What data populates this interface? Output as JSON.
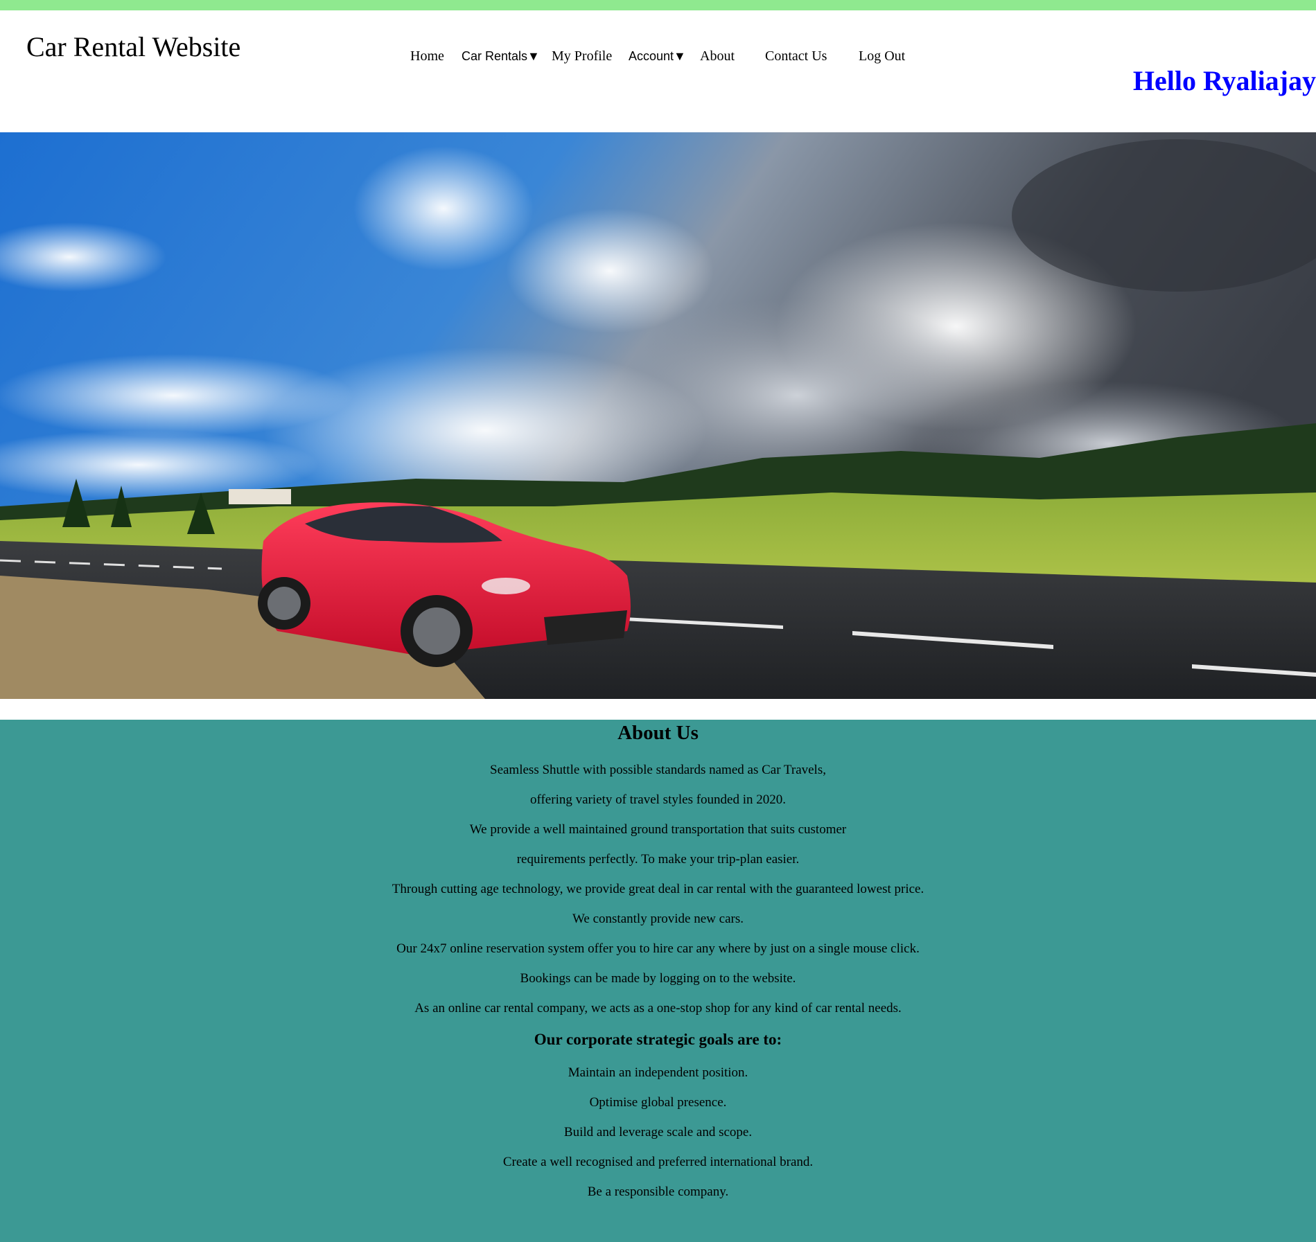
{
  "header": {
    "site_title": "Car Rental Website",
    "greeting": "Hello Ryaliajay",
    "nav": {
      "home": "Home",
      "car_rentals": "Car Rentals▼",
      "my_profile": "My Profile",
      "account": "Account▼",
      "about": "About",
      "contact": "Contact Us",
      "logout": "Log Out"
    }
  },
  "colors": {
    "top_strip": "#8fe98f",
    "about_bg": "#3c9994",
    "greeting": "#0000ff",
    "car": "#e8183a"
  },
  "about": {
    "heading": "About Us",
    "paragraphs": [
      "Seamless Shuttle with possible standards named as Car Travels,",
      "offering variety of travel styles founded in 2020.",
      "We provide a well maintained ground transportation that suits customer",
      "requirements perfectly. To make your trip-plan easier.",
      "Through cutting age technology, we provide great deal in car rental with the guaranteed lowest price.",
      "We constantly provide new cars.",
      "Our 24x7 online reservation system offer you to hire car any where by just on a single mouse click.",
      "Bookings can be made by logging on to the website.",
      "As an online car rental company, we acts as a one-stop shop for any kind of car rental needs."
    ],
    "goals_heading": "Our corporate strategic goals are to:",
    "goals": [
      "Maintain an independent position.",
      "Optimise global presence.",
      "Build and leverage scale and scope.",
      "Create a well recognised and preferred international brand.",
      "Be a responsible company."
    ]
  }
}
